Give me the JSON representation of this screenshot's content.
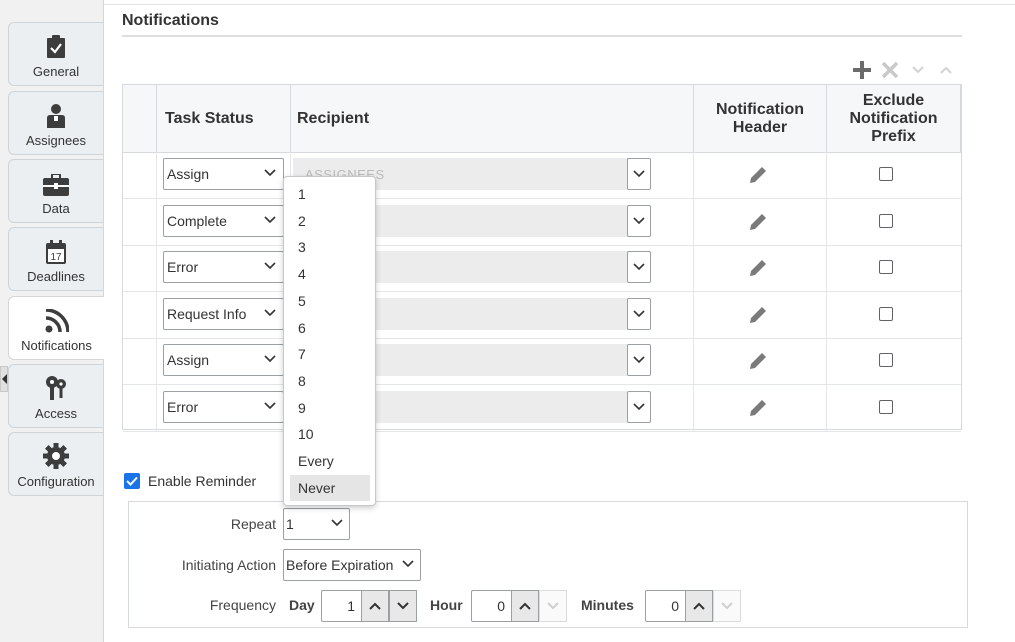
{
  "sidebar": {
    "tabs": [
      {
        "label": "General",
        "icon": "clipboard-check-icon",
        "active": false
      },
      {
        "label": "Assignees",
        "icon": "user-icon",
        "active": false
      },
      {
        "label": "Data",
        "icon": "briefcase-icon",
        "active": false
      },
      {
        "label": "Deadlines",
        "icon": "calendar-icon",
        "active": false,
        "icon_text": "17"
      },
      {
        "label": "Notifications",
        "icon": "rss-icon",
        "active": true
      },
      {
        "label": "Access",
        "icon": "keys-icon",
        "active": false
      },
      {
        "label": "Configuration",
        "icon": "gear-icon",
        "active": false
      }
    ]
  },
  "section": {
    "title": "Notifications"
  },
  "toolbar": {
    "buttons": [
      "add-icon",
      "delete-icon",
      "move-down-icon",
      "move-up-icon"
    ]
  },
  "table": {
    "headers": {
      "task_status": "Task Status",
      "recipient": "Recipient",
      "notification_header": "Notification Header",
      "exclude_prefix": "Exclude Notification Prefix"
    },
    "rows": [
      {
        "task_status": "Assign",
        "recipient": "ASSIGNEES"
      },
      {
        "task_status": "Complete",
        "recipient": ""
      },
      {
        "task_status": "Error",
        "recipient": ""
      },
      {
        "task_status": "Request Info",
        "recipient": ""
      },
      {
        "task_status": "Assign",
        "recipient": ""
      },
      {
        "task_status": "Error",
        "recipient": ""
      }
    ]
  },
  "repeat_dropdown": {
    "options": [
      "1",
      "2",
      "3",
      "4",
      "5",
      "6",
      "7",
      "8",
      "9",
      "10",
      "Every",
      "Never"
    ],
    "highlighted": "Never"
  },
  "reminder": {
    "enable_label": "Enable Reminder",
    "enabled": true,
    "repeat_label": "Repeat",
    "repeat_value": "1",
    "initiating_action_label": "Initiating Action",
    "initiating_action_value": "Before Expiration",
    "frequency_label": "Frequency",
    "day_label": "Day",
    "day_value": "1",
    "hour_label": "Hour",
    "hour_value": "0",
    "minutes_label": "Minutes",
    "minutes_value": "0"
  },
  "colors": {
    "accent": "#1a73e8",
    "icon": "#3d3d3d"
  }
}
